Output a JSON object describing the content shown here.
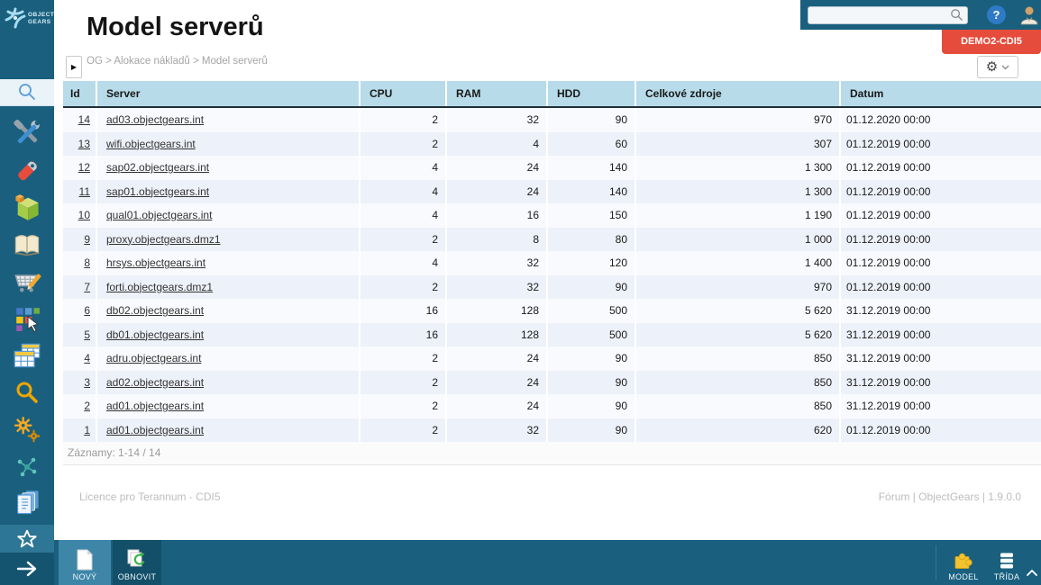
{
  "brand": {
    "line1": "OBJECT",
    "line2": "GEARS",
    "logo_icon": "objectgears-logo"
  },
  "topbar": {
    "search_value": "",
    "search_placeholder": "",
    "help_glyph": "?",
    "icons": [
      "search-icon",
      "help-icon",
      "user-icon"
    ],
    "env_badge": "DEMO2-CDI5"
  },
  "page": {
    "title": "Model serverů",
    "breadcrumb": "OG > Alokace nákladů > Model serverů",
    "collapse_glyph": "▶",
    "settings_gear_glyph": "⚙"
  },
  "sidebar": {
    "icons": [
      "search-icon",
      "tools-icon",
      "tag-icon",
      "model-cube-icon",
      "book-icon",
      "cart-icon",
      "apps-icon",
      "tables-icon",
      "fulltext-search-icon",
      "gears-icon",
      "network-icon",
      "documents-icon",
      "favorites-star-icon",
      "expand-arrow-icon"
    ]
  },
  "table": {
    "columns": [
      "Id",
      "Server",
      "CPU",
      "RAM",
      "HDD",
      "Celkové zdroje",
      "Datum"
    ],
    "rows": [
      [
        "14",
        "ad03.objectgears.int",
        "2",
        "32",
        "90",
        "970",
        "01.12.2020 00:00"
      ],
      [
        "13",
        "wifi.objectgears.int",
        "2",
        "4",
        "60",
        "307",
        "01.12.2019 00:00"
      ],
      [
        "12",
        "sap02.objectgears.int",
        "4",
        "24",
        "140",
        "1 300",
        "01.12.2019 00:00"
      ],
      [
        "11",
        "sap01.objectgears.int",
        "4",
        "24",
        "140",
        "1 300",
        "01.12.2019 00:00"
      ],
      [
        "10",
        "qual01.objectgears.int",
        "4",
        "16",
        "150",
        "1 190",
        "01.12.2019 00:00"
      ],
      [
        "9",
        "proxy.objectgears.dmz1",
        "2",
        "8",
        "80",
        "1 000",
        "01.12.2019 00:00"
      ],
      [
        "8",
        "hrsys.objectgears.int",
        "4",
        "32",
        "120",
        "1 400",
        "01.12.2019 00:00"
      ],
      [
        "7",
        "forti.objectgears.dmz1",
        "2",
        "32",
        "90",
        "970",
        "01.12.2019 00:00"
      ],
      [
        "6",
        "db02.objectgears.int",
        "16",
        "128",
        "500",
        "5 620",
        "31.12.2019 00:00"
      ],
      [
        "5",
        "db01.objectgears.int",
        "16",
        "128",
        "500",
        "5 620",
        "31.12.2019 00:00"
      ],
      [
        "4",
        "adru.objectgears.int",
        "2",
        "24",
        "90",
        "850",
        "31.12.2019 00:00"
      ],
      [
        "3",
        "ad02.objectgears.int",
        "2",
        "24",
        "90",
        "850",
        "31.12.2019 00:00"
      ],
      [
        "2",
        "ad01.objectgears.int",
        "2",
        "24",
        "90",
        "850",
        "31.12.2019 00:00"
      ],
      [
        "1",
        "ad01.objectgears.int",
        "2",
        "32",
        "90",
        "620",
        "01.12.2019 00:00"
      ]
    ],
    "records_info": "Záznamy: 1-14 / 14"
  },
  "footer": {
    "license": "Licence pro Terannum - CDI5",
    "meta": "Fórum | ObjectGears | 1.9.0.0"
  },
  "bottom_toolbar": {
    "new_label": "NOVÝ",
    "refresh_label": "OBNOVIT",
    "model_label": "MODEL",
    "class_label": "TŘÍDA"
  },
  "colors": {
    "teal": "#1a607e",
    "teal_light": "#2d7695",
    "teal_dark": "#15546f",
    "selected_tab": "#3e86a8",
    "header_bg": "#b7dbe9",
    "row_light": "#f8fafd",
    "row_alt": "#edf1f9",
    "badge_red": "#e64c3c",
    "help_blue": "#2e7ac6"
  }
}
